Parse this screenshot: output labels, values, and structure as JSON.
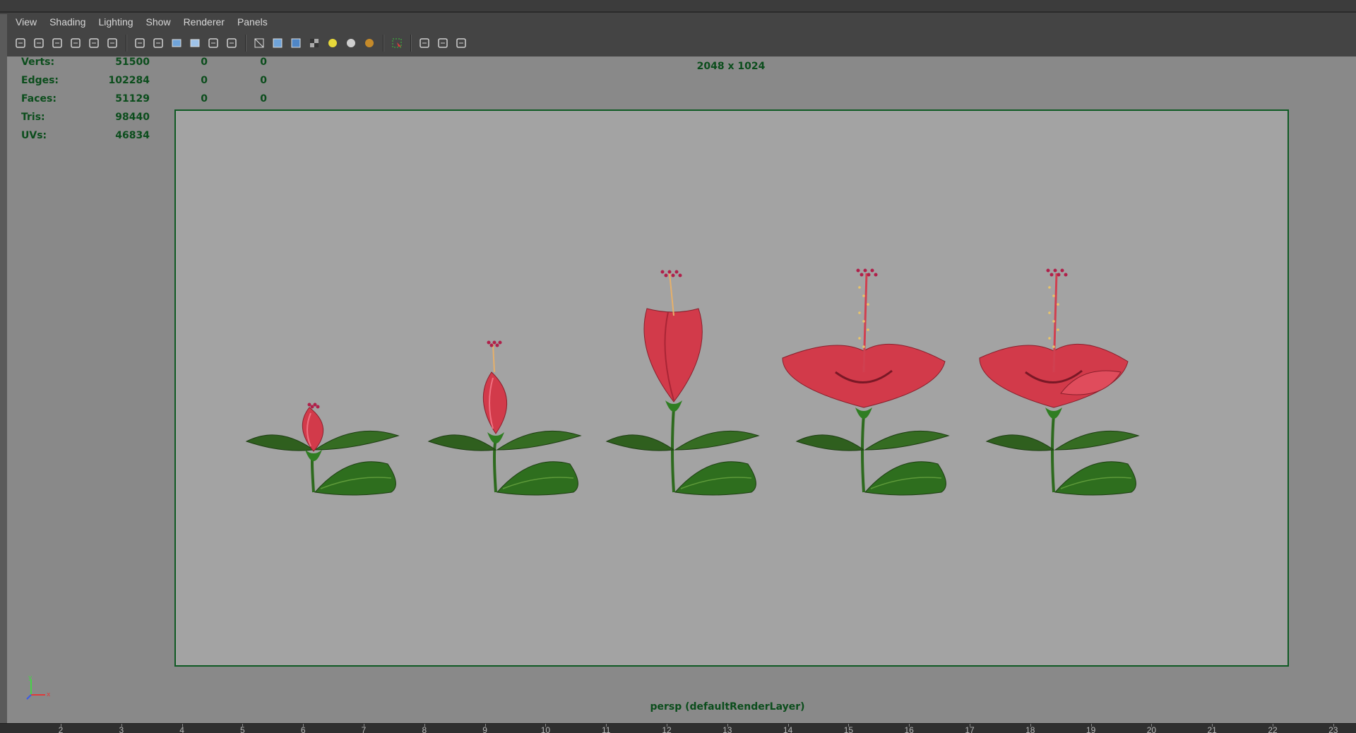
{
  "menu": [
    "View",
    "Shading",
    "Lighting",
    "Show",
    "Renderer",
    "Panels"
  ],
  "toolbar_icons": [
    "select-camera-icon",
    "camera-attributes-icon",
    "bookmark-icon",
    "image-plane-icon",
    "2d-pan-zoom-icon",
    "grease-pencil-icon",
    "sep",
    "grid-icon",
    "film-gate-icon",
    "resolution-gate-icon",
    "gate-mask-icon",
    "field-chart-icon",
    "safe-action-icon",
    "sep",
    "wireframe-icon",
    "smooth-shade-icon",
    "default-material-icon",
    "textured-icon",
    "default-light-icon",
    "all-lights-icon",
    "shadows-icon",
    "sep",
    "isolate-select-icon",
    "sep",
    "xray-icon",
    "xray-joints-icon",
    "xray-components-icon"
  ],
  "hud": {
    "rows": [
      {
        "label": "Verts:",
        "v0": "51500",
        "v1": "0",
        "v2": "0"
      },
      {
        "label": "Edges:",
        "v0": "102284",
        "v1": "0",
        "v2": "0"
      },
      {
        "label": "Faces:",
        "v0": "51129",
        "v1": "0",
        "v2": "0"
      },
      {
        "label": "Tris:",
        "v0": "98440",
        "v1": "0",
        "v2": "0"
      },
      {
        "label": "UVs:",
        "v0": "46834",
        "v1": "0",
        "v2": "0"
      }
    ]
  },
  "resolution": "2048 x 1024",
  "camera_label": "persp (defaultRenderLayer)",
  "scene": {
    "objects": [
      "hibiscus-bud-small",
      "hibiscus-bud-large",
      "hibiscus-half-open",
      "hibiscus-open",
      "hibiscus-full-bloom"
    ]
  },
  "ruler": {
    "labels": [
      "2",
      "3",
      "4",
      "5",
      "6",
      "7",
      "8",
      "9",
      "10",
      "11",
      "12",
      "13",
      "14",
      "15",
      "16",
      "17",
      "18",
      "19",
      "20",
      "21",
      "22",
      "23"
    ]
  },
  "colors": {
    "hud_text": "#0b4d1c",
    "gate_border": "#0f5a23",
    "viewport_bg": "#898989",
    "gate_bg": "#a3a3a3",
    "petal": "#d23a4a",
    "leaf": "#2e6e1e"
  }
}
